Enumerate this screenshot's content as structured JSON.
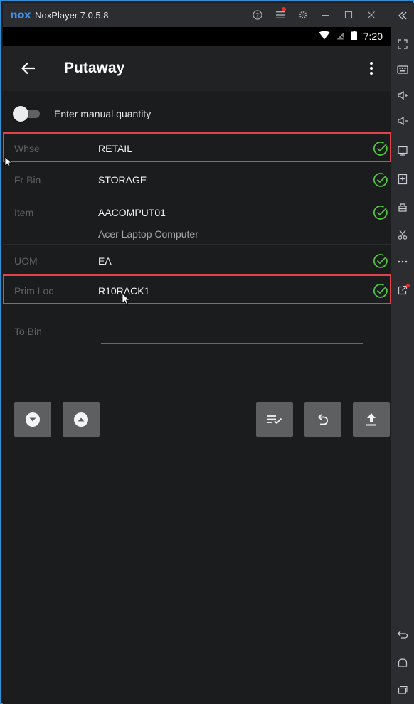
{
  "emulator": {
    "logo": "nox",
    "title": "NoxPlayer 7.0.5.8",
    "controls": [
      "help-icon",
      "menu-icon",
      "settings-icon",
      "minimize-icon",
      "maximize-icon",
      "close-icon",
      "collapse-icon"
    ]
  },
  "status_bar": {
    "time": "7:20"
  },
  "app_bar": {
    "title": "Putaway"
  },
  "manual_quantity": {
    "label": "Enter manual quantity",
    "enabled": false
  },
  "fields": [
    {
      "label": "Whse",
      "value": "RETAIL",
      "valid": true,
      "highlighted": true
    },
    {
      "label": "Fr Bin",
      "value": "STORAGE",
      "valid": true,
      "highlighted": false
    },
    {
      "label": "Item",
      "value": "AACOMPUT01",
      "description": "Acer Laptop Computer",
      "valid": true,
      "highlighted": false
    },
    {
      "label": "UOM",
      "value": "EA",
      "valid": true,
      "highlighted": false
    },
    {
      "label": "Prim Loc",
      "value": "R10RACK1",
      "valid": true,
      "highlighted": true
    }
  ],
  "to_bin": {
    "label": "To Bin",
    "value": "",
    "placeholder": ""
  },
  "buttons": {
    "left": [
      "scroll-down-icon",
      "scroll-up-icon"
    ],
    "right": [
      "list-check-icon",
      "undo-icon",
      "upload-icon"
    ]
  },
  "colors": {
    "accent_green": "#53c141",
    "highlight_red": "#e04449",
    "input_underline": "#4d6e99",
    "frame_blue": "#2c8fd6"
  }
}
